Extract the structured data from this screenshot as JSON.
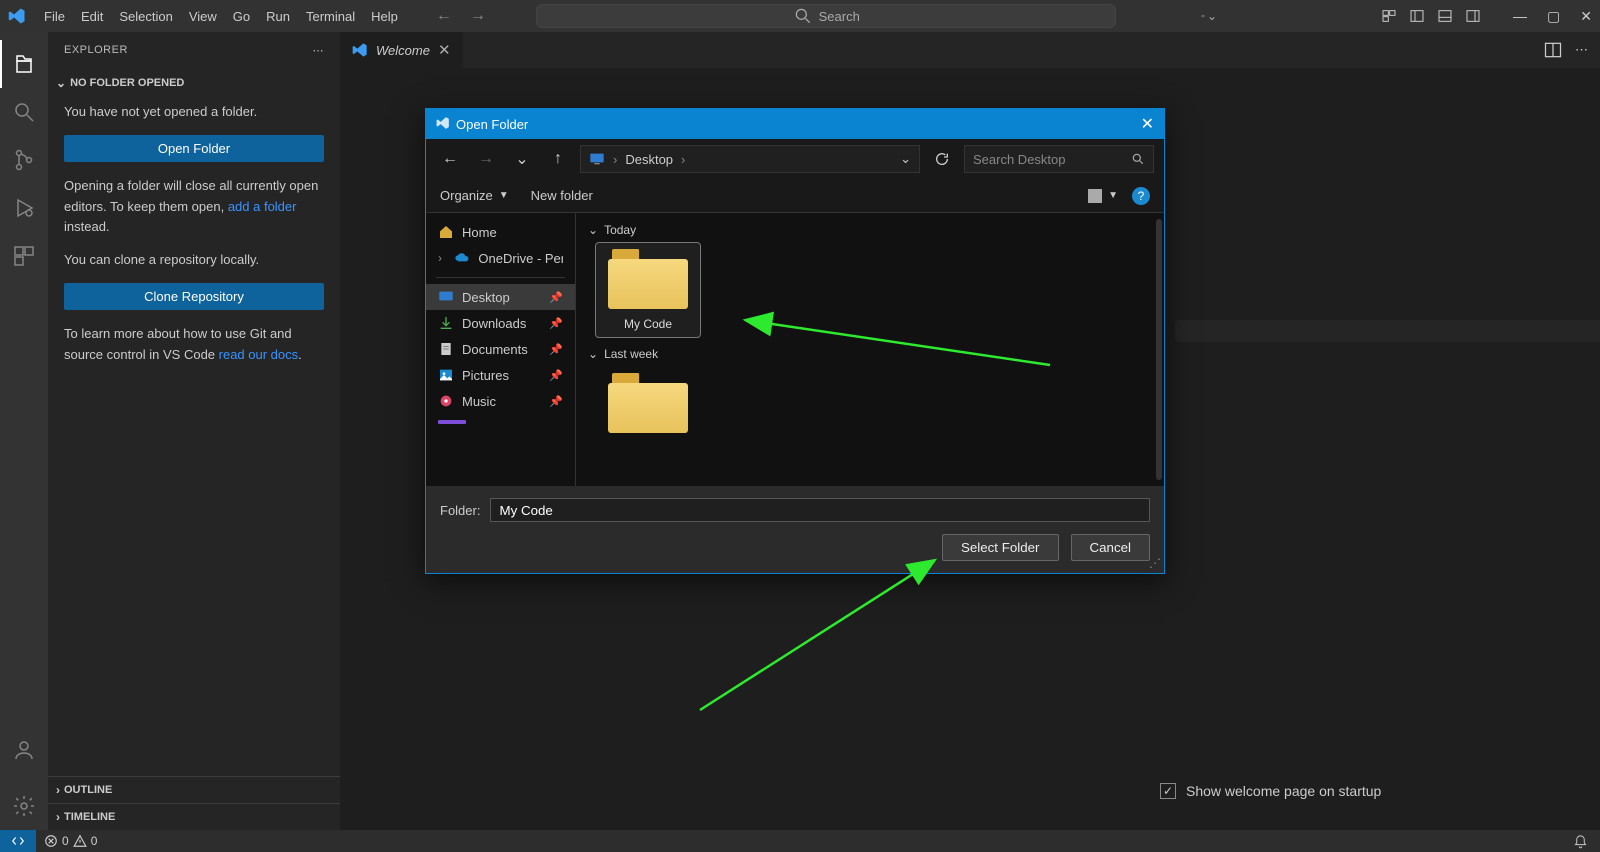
{
  "menubar": {
    "items": [
      "File",
      "Edit",
      "Selection",
      "View",
      "Go",
      "Run",
      "Terminal",
      "Help"
    ],
    "search_placeholder": "Search"
  },
  "sidebar": {
    "title": "EXPLORER",
    "noFolderTitle": "NO FOLDER OPENED",
    "not_opened": "You have not yet opened a folder.",
    "open_folder_btn": "Open Folder",
    "closing_hint_1": "Opening a folder will close all currently open editors. To keep them open, ",
    "closing_hint_link": "add a folder",
    "closing_hint_2": " instead.",
    "clone_hint": "You can clone a repository locally.",
    "clone_btn": "Clone Repository",
    "git_hint_1": "To learn more about how to use Git and source control in VS Code ",
    "git_hint_link": "read our docs",
    "git_hint_2": ".",
    "outline": "OUTLINE",
    "timeline": "TIMELINE"
  },
  "tab": {
    "label": "Welcome"
  },
  "welcome": {
    "startup_checkbox_label": "Show welcome page on startup"
  },
  "statusbar": {
    "errors": "0",
    "warnings": "0"
  },
  "dialog": {
    "title": "Open Folder",
    "breadcrumb": "Desktop",
    "search_placeholder": "Search Desktop",
    "organize": "Organize",
    "new_folder": "New folder",
    "tree": {
      "home": "Home",
      "onedrive": "OneDrive - Perso",
      "desktop": "Desktop",
      "downloads": "Downloads",
      "documents": "Documents",
      "pictures": "Pictures",
      "music": "Music"
    },
    "groups": {
      "today": "Today",
      "lastweek": "Last week"
    },
    "selected_folder_name": "My Code",
    "folder_field_label": "Folder:",
    "folder_field_value": "My Code",
    "select_btn": "Select Folder",
    "cancel_btn": "Cancel"
  }
}
